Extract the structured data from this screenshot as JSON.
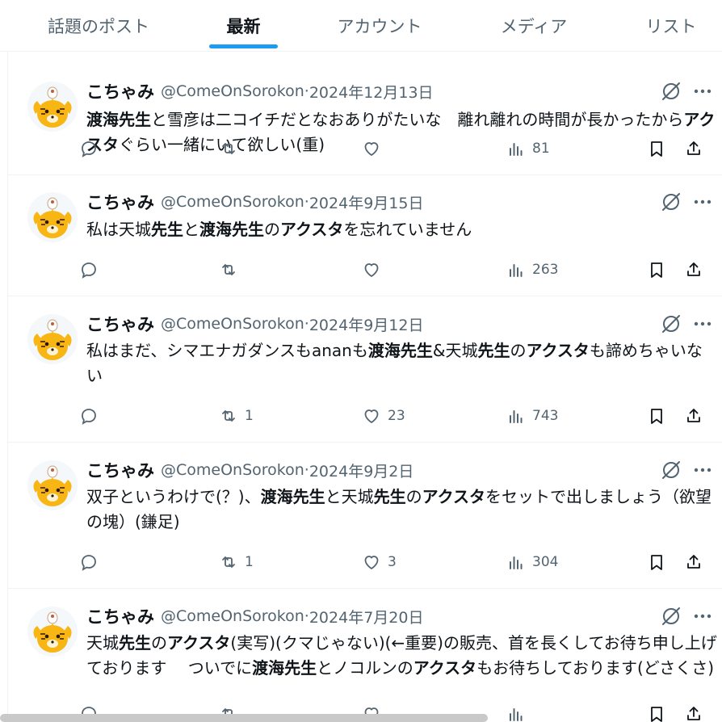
{
  "tabs": [
    {
      "label": "話題のポスト"
    },
    {
      "label": "最新"
    },
    {
      "label": "アカウント"
    },
    {
      "label": "メディア"
    },
    {
      "label": "リスト"
    }
  ],
  "colors": {
    "accent": "#1d9bf0",
    "text": "#0f1419",
    "muted": "#536471",
    "avatar": "#f7b614"
  },
  "icons": [
    "reply-icon",
    "retweet-icon",
    "like-icon",
    "views-icon",
    "bookmark-icon",
    "share-icon",
    "grok-icon",
    "more-icon"
  ],
  "tweets": [
    {
      "author": "こちゃみ",
      "handle": "@ComeOnSorokon",
      "date": "2024年12月13日",
      "segments": [
        {
          "t": "渡海先生",
          "b": true
        },
        {
          "t": "と雪彦は二コイチだとなおありがたいな　離れ離れの時間が長かったから",
          "b": false
        },
        {
          "t": "アクスタ",
          "b": true
        },
        {
          "t": "ぐらい一緒にいて欲しい(重)",
          "b": false
        }
      ],
      "reply": "",
      "retweet": "",
      "like": "",
      "views": "81"
    },
    {
      "author": "こちゃみ",
      "handle": "@ComeOnSorokon",
      "date": "2024年9月15日",
      "segments": [
        {
          "t": "私は天城",
          "b": false
        },
        {
          "t": "先生",
          "b": true
        },
        {
          "t": "と",
          "b": false
        },
        {
          "t": "渡海先生",
          "b": true
        },
        {
          "t": "の",
          "b": false
        },
        {
          "t": "アクスタ",
          "b": true
        },
        {
          "t": "を忘れていません",
          "b": false
        }
      ],
      "reply": "",
      "retweet": "",
      "like": "",
      "views": "263"
    },
    {
      "author": "こちゃみ",
      "handle": "@ComeOnSorokon",
      "date": "2024年9月12日",
      "segments": [
        {
          "t": "私はまだ、シマエナガダンスもananも",
          "b": false
        },
        {
          "t": "渡海先生",
          "b": true
        },
        {
          "t": "&天城",
          "b": false
        },
        {
          "t": "先生",
          "b": true
        },
        {
          "t": "の",
          "b": false
        },
        {
          "t": "アクスタ",
          "b": true
        },
        {
          "t": "も諦めちゃいない",
          "b": false
        }
      ],
      "reply": "",
      "retweet": "1",
      "like": "23",
      "views": "743"
    },
    {
      "author": "こちゃみ",
      "handle": "@ComeOnSorokon",
      "date": "2024年9月2日",
      "segments": [
        {
          "t": "双子というわけで(？)、",
          "b": false
        },
        {
          "t": "渡海先生",
          "b": true
        },
        {
          "t": "と天城",
          "b": false
        },
        {
          "t": "先生",
          "b": true
        },
        {
          "t": "の",
          "b": false
        },
        {
          "t": "アクスタ",
          "b": true
        },
        {
          "t": "をセットで出しましょう（欲望の塊）(鎌足)",
          "b": false
        }
      ],
      "reply": "",
      "retweet": "1",
      "like": "3",
      "views": "304"
    },
    {
      "author": "こちゃみ",
      "handle": "@ComeOnSorokon",
      "date": "2024年7月20日",
      "segments": [
        {
          "t": "天城",
          "b": false
        },
        {
          "t": "先生",
          "b": true
        },
        {
          "t": "の",
          "b": false
        },
        {
          "t": "アクスタ",
          "b": true
        },
        {
          "t": "(実写)(クマじゃない)(←重要)の販売、首を長くしてお待ち申し上げております　 ついでに",
          "b": false
        },
        {
          "t": "渡海先生",
          "b": true
        },
        {
          "t": "とノコルンの",
          "b": false
        },
        {
          "t": "アクスタ",
          "b": true
        },
        {
          "t": "もお待ちしております(どさくさ)",
          "b": false
        }
      ],
      "reply": "",
      "retweet": "",
      "like": "",
      "views": ""
    }
  ]
}
